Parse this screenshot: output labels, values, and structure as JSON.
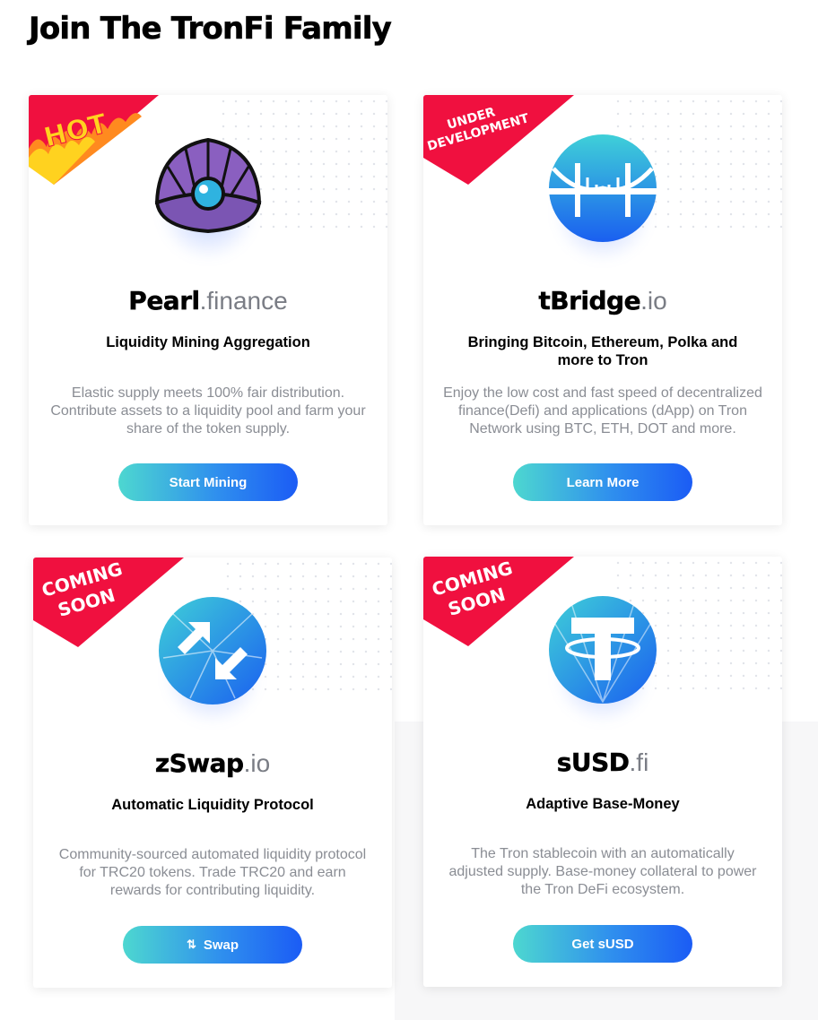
{
  "page": {
    "title": "Join The TronFi Family"
  },
  "cards": [
    {
      "badge": [
        "HOT"
      ],
      "brand_bold": "Pearl",
      "brand_light": ".finance",
      "subtitle": "Liquidity Mining Aggregation",
      "description": "Elastic supply meets 100% fair distribution. Contribute assets to a liquidity pool and farm your share of the token supply.",
      "button": "Start Mining",
      "logo": "pearl-shell-icon"
    },
    {
      "badge": [
        "UNDER",
        "DEVELOPMENT"
      ],
      "brand_bold": "tBridge",
      "brand_light": ".io",
      "subtitle": "Bringing Bitcoin, Ethereum, Polka and more to Tron",
      "description": "Enjoy the low cost and fast speed of decentralized finance(Defi) and applications (dApp) on Tron Network using BTC, ETH, DOT and more.",
      "button": "Learn More",
      "logo": "bridge-icon"
    },
    {
      "badge": [
        "COMING",
        "SOON"
      ],
      "brand_bold": "zSwap",
      "brand_light": ".io",
      "subtitle": "Automatic Liquidity Protocol",
      "description": "Community-sourced automated liquidity protocol for TRC20 tokens. Trade TRC20 and earn rewards for contributing liquidity.",
      "button": "Swap",
      "logo": "swap-arrows-icon"
    },
    {
      "badge": [
        "COMING",
        "SOON"
      ],
      "brand_bold": "sUSD",
      "brand_light": ".fi",
      "subtitle": "Adaptive Base-Money",
      "description": "The Tron stablecoin with an automatically adjusted supply. Base-money collateral to power the Tron DeFi ecosystem.",
      "button": "Get sUSD",
      "logo": "tether-t-icon"
    }
  ],
  "colors": {
    "badge_red": "#f0103f",
    "btn_start": "#4dd7d0",
    "btn_end": "#1b5cf5",
    "logo_blue": "#1e7df0"
  }
}
